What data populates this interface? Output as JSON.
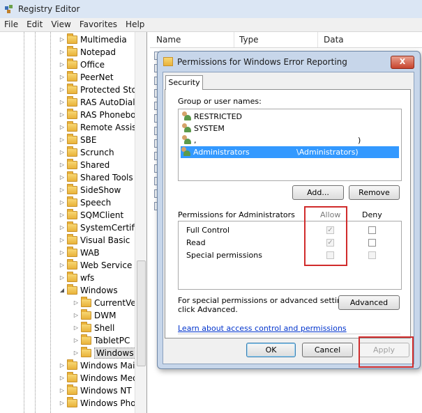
{
  "window": {
    "title": "Registry Editor",
    "menu": [
      "File",
      "Edit",
      "View",
      "Favorites",
      "Help"
    ]
  },
  "tree": {
    "items": [
      {
        "label": "Multimedia",
        "level": 1
      },
      {
        "label": "Notepad",
        "level": 1
      },
      {
        "label": "Office",
        "level": 1
      },
      {
        "label": "PeerNet",
        "level": 1
      },
      {
        "label": "Protected Sto",
        "level": 1
      },
      {
        "label": "RAS AutoDial",
        "level": 1
      },
      {
        "label": "RAS Phonebo",
        "level": 1
      },
      {
        "label": "Remote Assist",
        "level": 1
      },
      {
        "label": "SBE",
        "level": 1
      },
      {
        "label": "Scrunch",
        "level": 1
      },
      {
        "label": "Shared",
        "level": 1
      },
      {
        "label": "Shared Tools",
        "level": 1
      },
      {
        "label": "SideShow",
        "level": 1
      },
      {
        "label": "Speech",
        "level": 1
      },
      {
        "label": "SQMClient",
        "level": 1
      },
      {
        "label": "SystemCertifi",
        "level": 1
      },
      {
        "label": "Visual Basic",
        "level": 1
      },
      {
        "label": "WAB",
        "level": 1
      },
      {
        "label": "Web Service P",
        "level": 1
      },
      {
        "label": "wfs",
        "level": 1
      },
      {
        "label": "Windows",
        "level": 1,
        "expanded": true
      },
      {
        "label": "CurrentVe",
        "level": 2
      },
      {
        "label": "DWM",
        "level": 2
      },
      {
        "label": "Shell",
        "level": 2
      },
      {
        "label": "TabletPC",
        "level": 2
      },
      {
        "label": "Windows",
        "level": 2,
        "selected": true
      },
      {
        "label": "Windows Mai",
        "level": 1
      },
      {
        "label": "Windows Med",
        "level": 1
      },
      {
        "label": "Windows NT",
        "level": 1
      },
      {
        "label": "Windows Pho",
        "level": 1
      }
    ]
  },
  "list": {
    "columns": [
      "Name",
      "Type",
      "Data"
    ]
  },
  "dialog": {
    "title": "Permissions for Windows Error Reporting",
    "close_label": "X",
    "tab": "Security",
    "group_label": "Group or user names:",
    "users": [
      {
        "name": "RESTRICTED",
        "suffix": ""
      },
      {
        "name": "SYSTEM",
        "suffix": ""
      },
      {
        "name": ",",
        "suffix": ")"
      },
      {
        "name": "Administrators",
        "suffix": "\\Administrators)"
      }
    ],
    "add_button": "Add...",
    "remove_button": "Remove",
    "perm_label": "Permissions for Administrators",
    "allow_header": "Allow",
    "deny_header": "Deny",
    "permissions": [
      {
        "name": "Full Control",
        "allow": true,
        "deny": false
      },
      {
        "name": "Read",
        "allow": true,
        "deny": false
      },
      {
        "name": "Special permissions",
        "allow": false,
        "deny": false
      }
    ],
    "advanced_text_1": "For special permissions or advanced settings,",
    "advanced_text_2": "click Advanced.",
    "advanced_button": "Advanced",
    "help_link": "Learn about access control and permissions",
    "ok_button": "OK",
    "cancel_button": "Cancel",
    "apply_button": "Apply"
  },
  "colors": {
    "highlight_box": "#d02b2b",
    "selection": "#3399ff"
  }
}
